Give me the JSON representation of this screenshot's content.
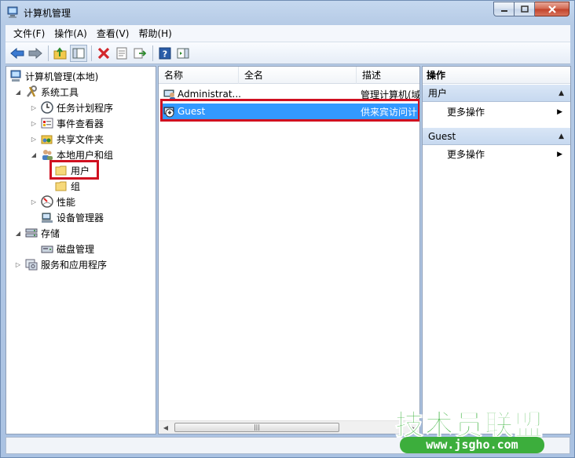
{
  "window": {
    "title": "计算机管理"
  },
  "menu": [
    "文件(F)",
    "操作(A)",
    "查看(V)",
    "帮助(H)"
  ],
  "tree": {
    "root": "计算机管理(本地)",
    "system_tools": "系统工具",
    "task_scheduler": "任务计划程序",
    "event_viewer": "事件查看器",
    "shared_folders": "共享文件夹",
    "local_users_groups": "本地用户和组",
    "users": "用户",
    "groups": "组",
    "performance": "性能",
    "device_manager": "设备管理器",
    "storage": "存储",
    "disk_management": "磁盘管理",
    "services_apps": "服务和应用程序"
  },
  "list": {
    "columns": {
      "name": "名称",
      "fullname": "全名",
      "description": "描述"
    },
    "rows": [
      {
        "name": "Administrat...",
        "fullname": "",
        "description": "管理计算机(域",
        "selected": false
      },
      {
        "name": "Guest",
        "fullname": "",
        "description": "供来宾访问计",
        "selected": true
      }
    ],
    "scroll_grip": "|||"
  },
  "actions": {
    "title": "操作",
    "group1": "用户",
    "group1_more": "更多操作",
    "group2": "Guest",
    "group2_more": "更多操作"
  },
  "watermark": {
    "main": "技术员联盟",
    "sub": "www.jsgho.com"
  },
  "colors": {
    "selection": "#3399ff",
    "highlight_box": "#d01020",
    "watermark": "#3db33f"
  }
}
